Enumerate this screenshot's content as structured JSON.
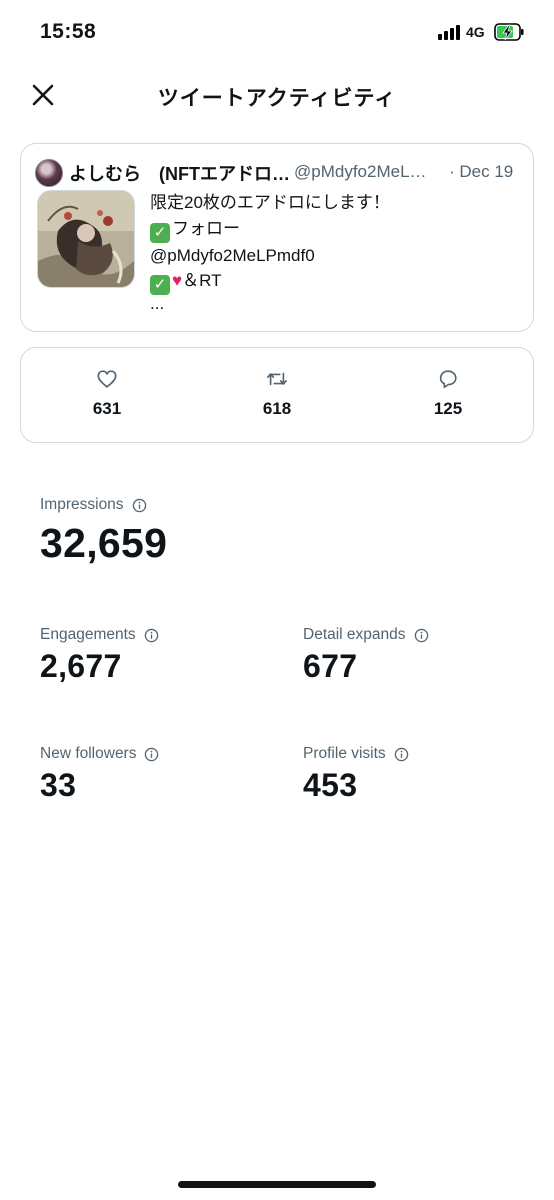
{
  "status_bar": {
    "time": "15:58",
    "network": "4G",
    "battery_state": "charging"
  },
  "header": {
    "title": "ツイートアクティビティ",
    "close_icon": "close-icon"
  },
  "tweet": {
    "author_name": "よしむら　(NFTエアドロ…",
    "handle": "@pMdyfo2MeL…",
    "date": "· Dec 19",
    "lines": [
      "限定20枚のエアドロにします！",
      "フォロー",
      "@pMdyfo2MeLPmdf0",
      "＆RT",
      "..."
    ]
  },
  "metrics": {
    "likes": "631",
    "retweets": "618",
    "replies": "125"
  },
  "stats": {
    "impressions": {
      "label": "Impressions",
      "value": "32,659"
    },
    "engagements": {
      "label": "Engagements",
      "value": "2,677"
    },
    "detail_expands": {
      "label": "Detail expands",
      "value": "677"
    },
    "new_followers": {
      "label": "New followers",
      "value": "33"
    },
    "profile_visits": {
      "label": "Profile visits",
      "value": "453"
    }
  },
  "colors": {
    "text": "#0f1419",
    "secondary": "#536471",
    "border": "#cfd9de",
    "check_green": "#4caf50",
    "heart_red": "#e0245e"
  }
}
